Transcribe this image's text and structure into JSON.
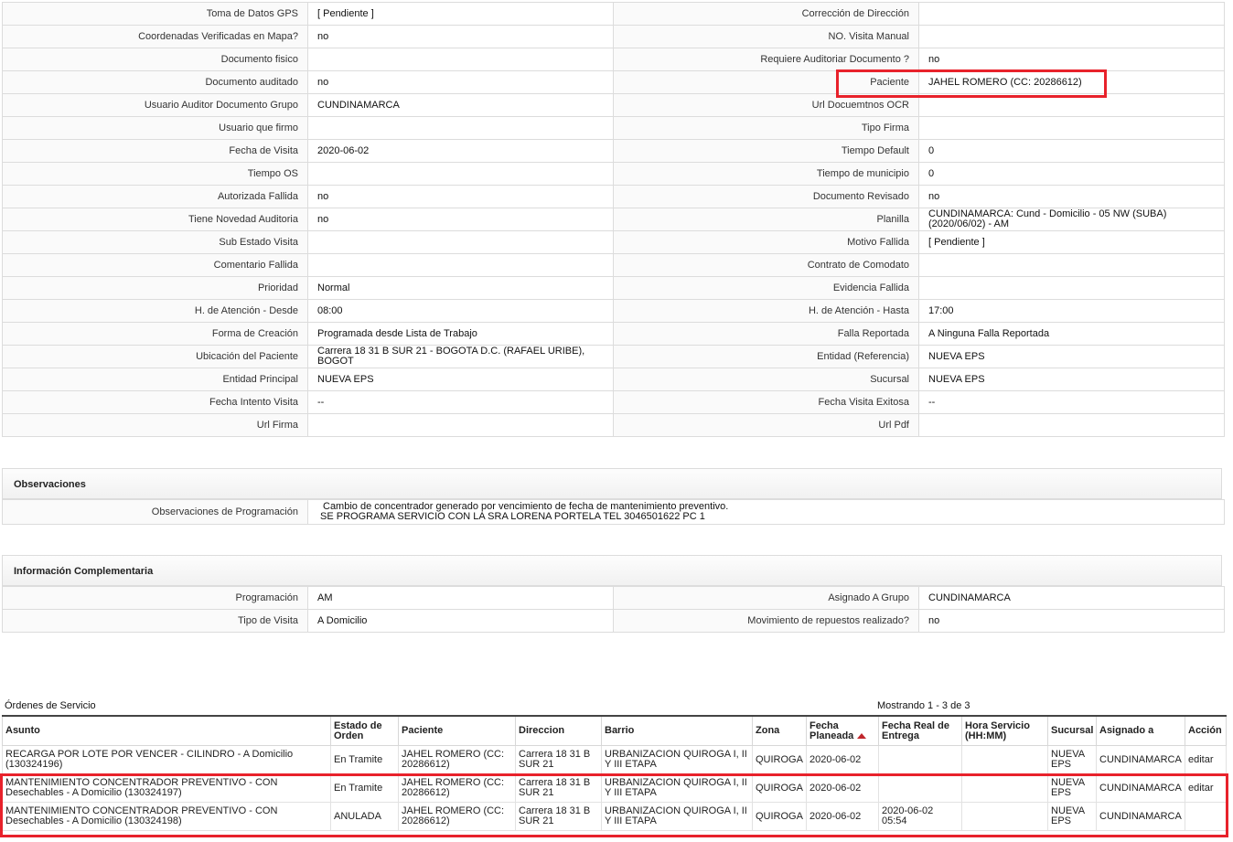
{
  "details": {
    "rows": [
      {
        "l1": "Toma de Datos GPS",
        "v1": "[ Pendiente ]",
        "l2": "Corrección de Dirección",
        "v2": ""
      },
      {
        "l1": "Coordenadas Verificadas en Mapa?",
        "v1": "no",
        "l2": "NO. Visita Manual",
        "v2": ""
      },
      {
        "l1": "Documento fisico",
        "v1": "",
        "l2": "Requiere Auditoriar Documento ?",
        "v2": "no"
      },
      {
        "l1": "Documento auditado",
        "v1": "no",
        "l2": "Paciente",
        "v2": "JAHEL ROMERO (CC: 20286612)"
      },
      {
        "l1": "Usuario Auditor Documento Grupo",
        "v1": "CUNDINAMARCA",
        "l2": "Url Docuemtnos OCR",
        "v2": ""
      },
      {
        "l1": "Usuario que firmo",
        "v1": "",
        "l2": "Tipo Firma",
        "v2": ""
      },
      {
        "l1": "Fecha de Visita",
        "v1": "2020-06-02",
        "l2": "Tiempo Default",
        "v2": "0"
      },
      {
        "l1": "Tiempo OS",
        "v1": "",
        "l2": "Tiempo de municipio",
        "v2": "0"
      },
      {
        "l1": "Autorizada Fallida",
        "v1": "no",
        "l2": "Documento Revisado",
        "v2": "no"
      },
      {
        "l1": "Tiene Novedad Auditoria",
        "v1": "no",
        "l2": "Planilla",
        "v2": "CUNDINAMARCA: Cund - Domicilio - 05 NW (SUBA) (2020/06/02) - AM"
      },
      {
        "l1": "Sub Estado Visita",
        "v1": "",
        "l2": "Motivo Fallida",
        "v2": "[ Pendiente ]"
      },
      {
        "l1": "Comentario Fallida",
        "v1": "",
        "l2": "Contrato de Comodato",
        "v2": ""
      },
      {
        "l1": "Prioridad",
        "v1": "Normal",
        "l2": "Evidencia Fallida",
        "v2": ""
      },
      {
        "l1": "H. de Atención - Desde",
        "v1": "08:00",
        "l2": "H. de Atención - Hasta",
        "v2": "17:00"
      },
      {
        "l1": "Forma de Creación",
        "v1": "Programada desde Lista de Trabajo",
        "l2": "Falla Reportada",
        "v2": "A Ninguna Falla Reportada"
      },
      {
        "l1": "Ubicación del Paciente",
        "v1": "Carrera 18 31 B SUR 21 - BOGOTA D.C. (RAFAEL URIBE), BOGOT",
        "l2": "Entidad (Referencia)",
        "v2": "NUEVA EPS"
      },
      {
        "l1": "Entidad Principal",
        "v1": "NUEVA EPS",
        "l2": "Sucursal",
        "v2": "NUEVA EPS"
      },
      {
        "l1": "Fecha Intento Visita",
        "v1": "--",
        "l2": "Fecha Visita Exitosa",
        "v2": "--"
      },
      {
        "l1": "Url Firma",
        "v1": "",
        "l2": "Url Pdf",
        "v2": ""
      }
    ]
  },
  "observaciones": {
    "title": "Observaciones",
    "label": "Observaciones de Programación",
    "line1": "Cambio de concentrador generado por vencimiento de fecha de mantenimiento preventivo.",
    "line2": "SE PROGRAMA SERVICIO CON LA SRA LORENA PORTELA TEL 3046501622 PC 1"
  },
  "complementaria": {
    "title": "Información Complementaria",
    "rows": [
      {
        "l1": "Programación",
        "v1": "AM",
        "l2": "Asignado A Grupo",
        "v2": "CUNDINAMARCA"
      },
      {
        "l1": "Tipo de Visita",
        "v1": "A Domicilio",
        "l2": "Movimiento de repuestos realizado?",
        "v2": "no"
      }
    ]
  },
  "orders": {
    "title": "Órdenes de Servicio",
    "count": "Mostrando 1 - 3 de 3",
    "headers": [
      "Asunto",
      "Estado de Orden",
      "Paciente",
      "Direccion",
      "Barrio",
      "Zona",
      "Fecha Planeada",
      "Fecha Real de Entrega",
      "Hora Servicio (HH:MM)",
      "Sucursal",
      "Asignado a",
      "Acción"
    ],
    "rows": [
      [
        "RECARGA POR LOTE POR VENCER - CILINDRO - A Domicilio (130324196)",
        "En Tramite",
        "JAHEL ROMERO (CC: 20286612)",
        "Carrera 18 31 B SUR 21",
        "URBANIZACION QUIROGA I, II Y III ETAPA",
        "QUIROGA",
        "2020-06-02",
        "",
        "",
        "NUEVA EPS",
        "CUNDINAMARCA",
        "editar"
      ],
      [
        "MANTENIMIENTO CONCENTRADOR PREVENTIVO - CON Desechables - A Domicilio (130324197)",
        "En Tramite",
        "JAHEL ROMERO (CC: 20286612)",
        "Carrera 18 31 B SUR 21",
        "URBANIZACION QUIROGA I, II Y III ETAPA",
        "QUIROGA",
        "2020-06-02",
        "",
        "",
        "NUEVA EPS",
        "CUNDINAMARCA",
        "editar"
      ],
      [
        "MANTENIMIENTO CONCENTRADOR PREVENTIVO - CON Desechables - A Domicilio (130324198)",
        "ANULADA",
        "JAHEL ROMERO (CC: 20286612)",
        "Carrera 18 31 B SUR 21",
        "URBANIZACION QUIROGA I, II Y III ETAPA",
        "QUIROGA",
        "2020-06-02",
        "2020-06-02 05:54",
        "",
        "NUEVA EPS",
        "CUNDINAMARCA",
        ""
      ]
    ]
  },
  "colors": {
    "highlight": "#e8222b",
    "sort_arrow": "#c0262c"
  },
  "icons": {
    "sort": "sort-asc-icon"
  }
}
